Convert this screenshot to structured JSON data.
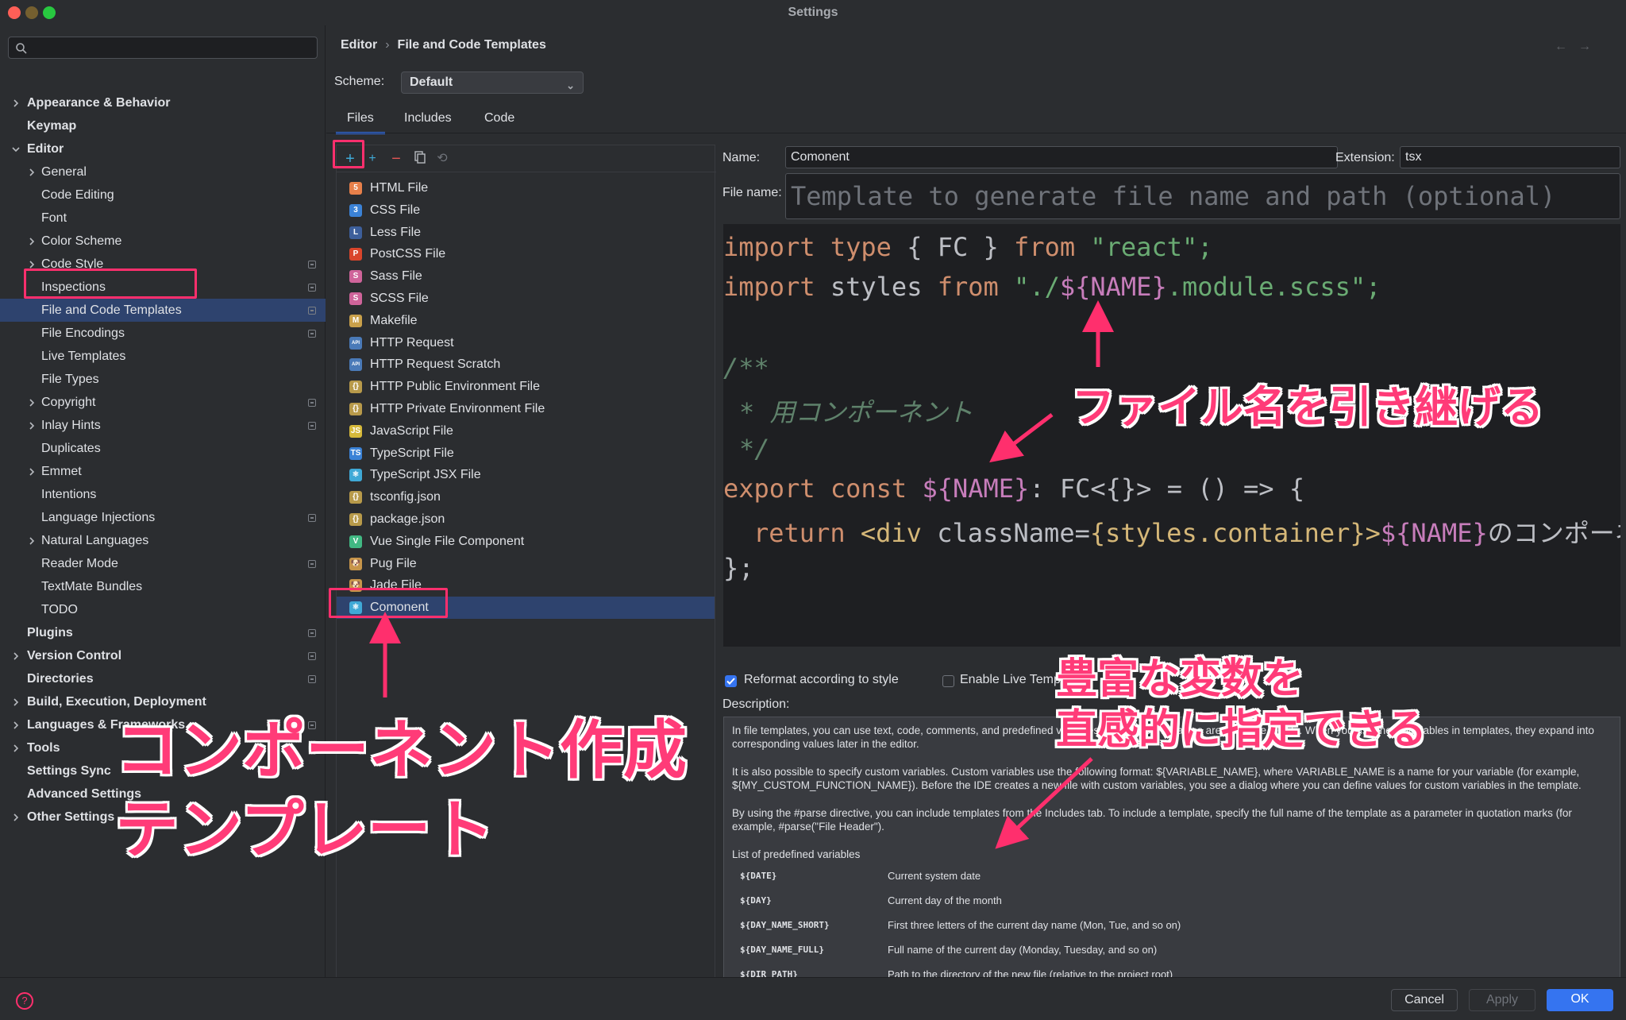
{
  "window": {
    "title": "Settings"
  },
  "sidebar": {
    "search_placeholder": "",
    "items": [
      {
        "label": "Appearance & Behavior",
        "level": 0,
        "chev": "right",
        "bold": true,
        "badge": false
      },
      {
        "label": "Keymap",
        "level": 0,
        "chev": "",
        "bold": true,
        "badge": false
      },
      {
        "label": "Editor",
        "level": 0,
        "chev": "down",
        "bold": true,
        "badge": false
      },
      {
        "label": "General",
        "level": 1,
        "chev": "right",
        "bold": false,
        "badge": false
      },
      {
        "label": "Code Editing",
        "level": 1,
        "chev": "",
        "bold": false,
        "badge": false
      },
      {
        "label": "Font",
        "level": 1,
        "chev": "",
        "bold": false,
        "badge": false
      },
      {
        "label": "Color Scheme",
        "level": 1,
        "chev": "right",
        "bold": false,
        "badge": false
      },
      {
        "label": "Code Style",
        "level": 1,
        "chev": "right",
        "bold": false,
        "badge": true
      },
      {
        "label": "Inspections",
        "level": 1,
        "chev": "",
        "bold": false,
        "badge": true
      },
      {
        "label": "File and Code Templates",
        "level": 1,
        "chev": "",
        "bold": false,
        "badge": true,
        "selected": true
      },
      {
        "label": "File Encodings",
        "level": 1,
        "chev": "",
        "bold": false,
        "badge": true
      },
      {
        "label": "Live Templates",
        "level": 1,
        "chev": "",
        "bold": false,
        "badge": false
      },
      {
        "label": "File Types",
        "level": 1,
        "chev": "",
        "bold": false,
        "badge": false
      },
      {
        "label": "Copyright",
        "level": 1,
        "chev": "right",
        "bold": false,
        "badge": true
      },
      {
        "label": "Inlay Hints",
        "level": 1,
        "chev": "right",
        "bold": false,
        "badge": true
      },
      {
        "label": "Duplicates",
        "level": 1,
        "chev": "",
        "bold": false,
        "badge": false
      },
      {
        "label": "Emmet",
        "level": 1,
        "chev": "right",
        "bold": false,
        "badge": false
      },
      {
        "label": "Intentions",
        "level": 1,
        "chev": "",
        "bold": false,
        "badge": false
      },
      {
        "label": "Language Injections",
        "level": 1,
        "chev": "",
        "bold": false,
        "badge": true
      },
      {
        "label": "Natural Languages",
        "level": 1,
        "chev": "right",
        "bold": false,
        "badge": false
      },
      {
        "label": "Reader Mode",
        "level": 1,
        "chev": "",
        "bold": false,
        "badge": true
      },
      {
        "label": "TextMate Bundles",
        "level": 1,
        "chev": "",
        "bold": false,
        "badge": false
      },
      {
        "label": "TODO",
        "level": 1,
        "chev": "",
        "bold": false,
        "badge": false
      },
      {
        "label": "Plugins",
        "level": 0,
        "chev": "",
        "bold": true,
        "badge": true
      },
      {
        "label": "Version Control",
        "level": 0,
        "chev": "right",
        "bold": true,
        "badge": true
      },
      {
        "label": "Directories",
        "level": 0,
        "chev": "",
        "bold": true,
        "badge": true
      },
      {
        "label": "Build, Execution, Deployment",
        "level": 0,
        "chev": "right",
        "bold": true,
        "badge": false
      },
      {
        "label": "Languages & Frameworks",
        "level": 0,
        "chev": "right",
        "bold": true,
        "badge": true
      },
      {
        "label": "Tools",
        "level": 0,
        "chev": "right",
        "bold": true,
        "badge": false
      },
      {
        "label": "Settings Sync",
        "level": 0,
        "chev": "",
        "bold": true,
        "badge": false
      },
      {
        "label": "Advanced Settings",
        "level": 0,
        "chev": "",
        "bold": true,
        "badge": false
      },
      {
        "label": "Other Settings",
        "level": 0,
        "chev": "right",
        "bold": true,
        "badge": false
      }
    ]
  },
  "breadcrumb": {
    "parent": "Editor",
    "separator": "›",
    "current": "File and Code Templates"
  },
  "scheme": {
    "label": "Scheme:",
    "value": "Default"
  },
  "tabs": [
    {
      "label": "Files",
      "active": true
    },
    {
      "label": "Includes",
      "active": false
    },
    {
      "label": "Code",
      "active": false
    }
  ],
  "templates": [
    {
      "label": "HTML File",
      "icon": "html-icon",
      "color": "#e8804a",
      "glyph": "5"
    },
    {
      "label": "CSS File",
      "icon": "css-icon",
      "color": "#3b82d6",
      "glyph": "3"
    },
    {
      "label": "Less File",
      "icon": "less-icon",
      "color": "#3d5f9b",
      "glyph": "L"
    },
    {
      "label": "PostCSS File",
      "icon": "postcss-icon",
      "color": "#d9452b",
      "glyph": "P"
    },
    {
      "label": "Sass File",
      "icon": "sass-icon",
      "color": "#cf649a",
      "glyph": "S"
    },
    {
      "label": "SCSS File",
      "icon": "scss-icon",
      "color": "#cf649a",
      "glyph": "S"
    },
    {
      "label": "Makefile",
      "icon": "makefile-icon",
      "color": "#c9a04a",
      "glyph": "M"
    },
    {
      "label": "HTTP Request",
      "icon": "http-request-icon",
      "color": "#4a7ab8",
      "glyph": "API"
    },
    {
      "label": "HTTP Request Scratch",
      "icon": "http-scratch-icon",
      "color": "#4a7ab8",
      "glyph": "API"
    },
    {
      "label": "HTTP Public Environment File",
      "icon": "json-icon",
      "color": "#b89a4a",
      "glyph": "{}"
    },
    {
      "label": "HTTP Private Environment File",
      "icon": "json-icon",
      "color": "#b89a4a",
      "glyph": "{}"
    },
    {
      "label": "JavaScript File",
      "icon": "javascript-icon",
      "color": "#d6b93a",
      "glyph": "JS"
    },
    {
      "label": "TypeScript File",
      "icon": "typescript-icon",
      "color": "#3b82d6",
      "glyph": "TS"
    },
    {
      "label": "TypeScript JSX File",
      "icon": "react-icon",
      "color": "#3fa9d6",
      "glyph": "⚛"
    },
    {
      "label": "tsconfig.json",
      "icon": "json-icon",
      "color": "#b89a4a",
      "glyph": "{}"
    },
    {
      "label": "package.json",
      "icon": "json-icon",
      "color": "#b89a4a",
      "glyph": "{}"
    },
    {
      "label": "Vue Single File Component",
      "icon": "vue-icon",
      "color": "#41b883",
      "glyph": "V"
    },
    {
      "label": "Pug File",
      "icon": "pug-icon",
      "color": "#c7954a",
      "glyph": "🐶"
    },
    {
      "label": "Jade File",
      "icon": "jade-icon",
      "color": "#c7954a",
      "glyph": "🐶"
    },
    {
      "label": "Comonent",
      "icon": "react-icon",
      "color": "#3fa9d6",
      "glyph": "⚛",
      "selected": true
    }
  ],
  "form": {
    "name_label": "Name:",
    "name_value": "Comonent",
    "extension_label": "Extension:",
    "extension_value": "tsx",
    "filename_label": "File name:",
    "filename_placeholder": "Template to generate file name and path (optional)"
  },
  "code": {
    "line1": [
      "import",
      "type",
      "{",
      "FC",
      "}",
      "from",
      "\"react\";"
    ],
    "line2": [
      "import",
      "styles",
      "from",
      "\"./",
      "${NAME}",
      ".module.scss\";"
    ],
    "line4": "/**",
    "line5": "* 用コンポーネント",
    "line6": "*/",
    "line7": [
      "export",
      "const",
      "${NAME}",
      ": FC<{}> = () => {"
    ],
    "line8": [
      "return",
      "<div",
      "className=",
      "{styles.container}",
      ">",
      "${NAME}",
      "のコンポーネント"
    ],
    "line9": "};"
  },
  "options": {
    "reformat_label": "Reformat according to style",
    "reformat_checked": true,
    "live_label": "Enable Live Templates",
    "live_checked": false,
    "description_label": "Description:"
  },
  "description": {
    "p1": "In file templates, you can use text, code, comments, and predefined variables. Predefined variables are available in lists. When you use these variables in templates, they expand into corresponding values later in the editor.",
    "p2": "It is also possible to specify custom variables. Custom variables use the following format: ${VARIABLE_NAME}, where VARIABLE_NAME is a name for your variable (for example, ${MY_CUSTOM_FUNCTION_NAME}). Before the IDE creates a new file with custom variables, you see a dialog where you can define values for custom variables in the template.",
    "p3": "By using the #parse directive, you can include templates from the Includes tab. To include a template, specify the full name of the template as a parameter in quotation marks (for example, #parse(\"File Header\").",
    "list_title": "List of predefined variables",
    "vars": [
      {
        "name": "${DATE}",
        "desc": "Current system date"
      },
      {
        "name": "${DAY}",
        "desc": "Current day of the month"
      },
      {
        "name": "${DAY_NAME_SHORT}",
        "desc": "First three letters of the current day name (Mon, Tue, and so on)"
      },
      {
        "name": "${DAY_NAME_FULL}",
        "desc": "Full name of the current day (Monday, Tuesday, and so on)"
      },
      {
        "name": "${DIR_PATH}",
        "desc": "Path to the directory of the new file (relative to the project root)"
      }
    ]
  },
  "footer": {
    "cancel": "Cancel",
    "apply": "Apply",
    "ok": "OK",
    "help": "?"
  },
  "annotations": {
    "a1": "ファイル名を引き継げる",
    "a2_line1": "豊富な変数を",
    "a2_line2": "直感的に指定できる",
    "a3_line1": "コンポーネント作成",
    "a3_line2": "テンプレート"
  },
  "colors": {
    "accent": "#3574f0",
    "highlight": "#ff2f6d",
    "selection": "#2e436e"
  }
}
